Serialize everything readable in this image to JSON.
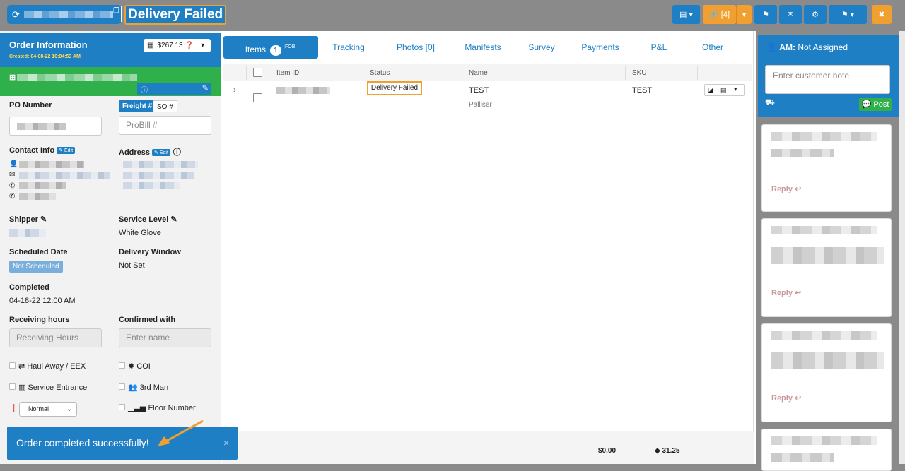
{
  "header": {
    "title": "Delivery Failed",
    "link_count": "[4]"
  },
  "order_info": {
    "title": "Order Information",
    "created": "Created: 04-08-22 10:04:53 AM",
    "price": "$267.13",
    "po_label": "PO Number",
    "freight_tab": "Freight #",
    "so_tab": "SO #",
    "probill_placeholder": "ProBill #",
    "contact_label": "Contact Info",
    "address_label": "Address",
    "edit_label": "Edit",
    "shipper_label": "Shipper",
    "service_level_label": "Service Level",
    "service_level_value": "White Glove",
    "scheduled_label": "Scheduled Date",
    "scheduled_value": "Not Scheduled",
    "window_label": "Delivery Window",
    "window_value": "Not Set",
    "completed_label": "Completed",
    "completed_value": "04-18-22 12:00 AM",
    "receiving_label": "Receiving hours",
    "receiving_placeholder": "Receiving Hours",
    "confirmed_label": "Confirmed with",
    "confirmed_placeholder": "Enter name",
    "checks": {
      "haul_away": "Haul Away / EEX",
      "coi": "COI",
      "service_entrance": "Service Entrance",
      "third_man": "3rd Man",
      "floor_number": "Floor Number"
    },
    "priority_value": "Normal"
  },
  "tabs": {
    "items": "Items",
    "items_count": "1",
    "items_sup": "[FOB]",
    "tracking": "Tracking",
    "photos": "Photos [0]",
    "manifests": "Manifests",
    "survey": "Survey",
    "payments": "Payments",
    "pl": "P&L",
    "other": "Other"
  },
  "table": {
    "headers": {
      "item_id": "Item ID",
      "status": "Status",
      "name": "Name",
      "sku": "SKU"
    },
    "row": {
      "status": "Delivery Failed",
      "name": "TEST",
      "subname": "Palliser",
      "sku": "TEST"
    },
    "footer_total": "$0.00",
    "footer_cube": "31.25"
  },
  "notes": {
    "am": "AM:",
    "am_value": "Not Assigned",
    "placeholder": "Enter customer note",
    "post": "Post",
    "reply": "Reply"
  },
  "toast": {
    "message": "Order completed successfully!",
    "close": "×"
  },
  "colors": {
    "primary": "#1e7fc4",
    "accent": "#f0a030",
    "success": "#2fb04a"
  }
}
